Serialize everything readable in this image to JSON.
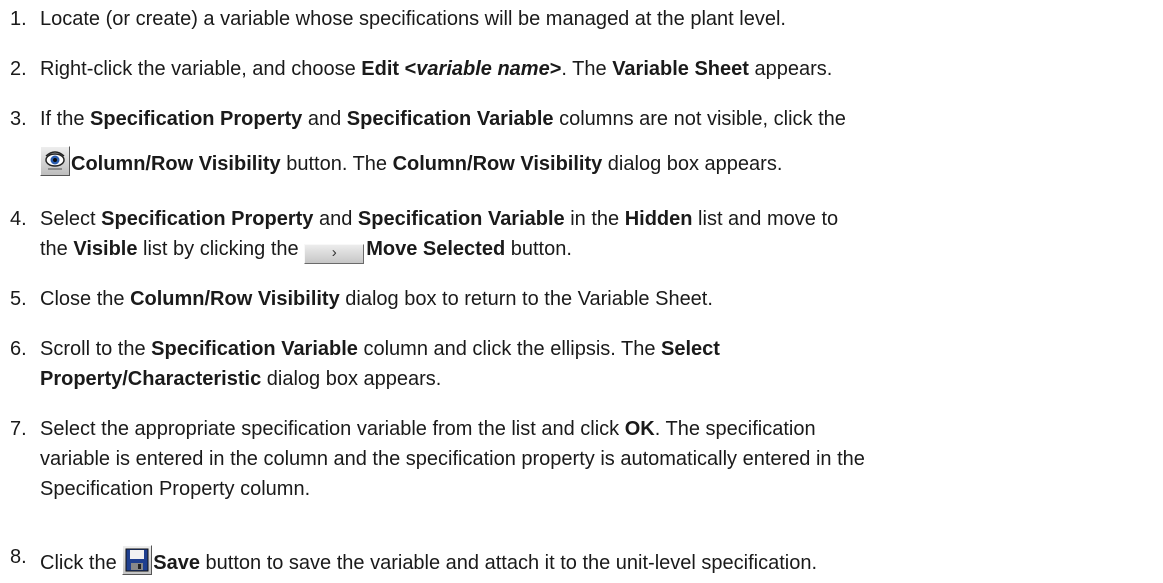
{
  "steps": [
    {
      "number": "1.",
      "text": "Locate (or create) a variable whose specifications will be managed at the plant level."
    },
    {
      "number": "2.",
      "t1": "Right-click the variable, and choose ",
      "b1": "Edit <",
      "i1": "variable name",
      "b2": ">",
      "t2": ". The ",
      "b3": "Variable Sheet",
      "t3": " appears."
    },
    {
      "number": "3.",
      "t1": "If the ",
      "b1": "Specification Property",
      "t2": " and ",
      "b2": "Specification Variable",
      "t3": " columns are not visible, click the",
      "icon": "column-row-visibility-icon",
      "b3": "Column/Row Visibility",
      "t4": " button. The ",
      "b4": "Column/Row Visibility",
      "t5": " dialog box appears."
    },
    {
      "number": "4.",
      "t1": "Select ",
      "b1": "Specification Property",
      "t2": " and ",
      "b2": "Specification Variable",
      "t3": " in the ",
      "b3": "Hidden",
      "t4": " list and move to",
      "t5": "the ",
      "b4": "Visible",
      "t6": " list by clicking the ",
      "icon_glyph": "›",
      "b5": "Move Selected",
      "t7": " button."
    },
    {
      "number": "5.",
      "t1": "Close the ",
      "b1": "Column/Row Visibility",
      "t2": " dialog box to return to the Variable Sheet."
    },
    {
      "number": "6.",
      "t1": "Scroll to the ",
      "b1": "Specification Variable",
      "t2": " column and click the ellipsis. The ",
      "b2": "Select",
      "b3": "Property/Characteristic",
      "t3": " dialog box appears."
    },
    {
      "number": "7.",
      "t1": "Select the appropriate specification variable from the list and click ",
      "b1": "OK",
      "t2": ". The specification",
      "line2": "variable is entered in the column and the specification property is automatically entered in the",
      "line3": "Specification Property column."
    },
    {
      "number": "8.",
      "t1": "Click the ",
      "icon": "save-icon",
      "b1": "Save",
      "t2": " button to save the variable and attach it to the unit-level specification."
    }
  ]
}
